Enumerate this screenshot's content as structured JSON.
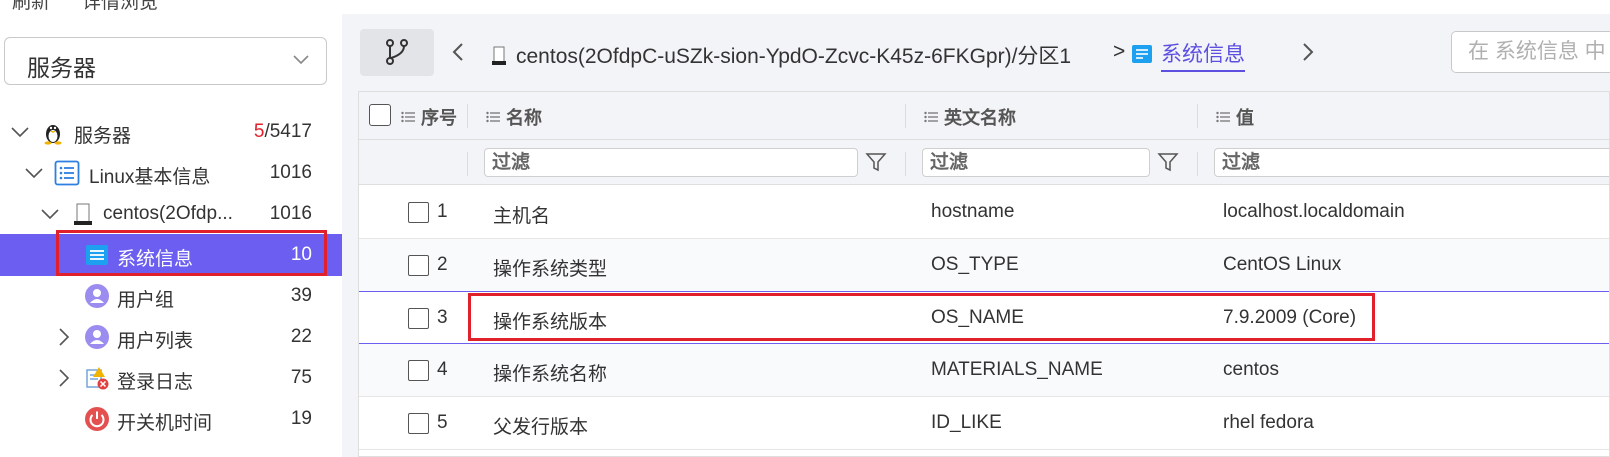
{
  "top_strip": {
    "left_text": "刷新",
    "right_text": "详情浏览"
  },
  "sidebar": {
    "dropdown": {
      "value": "服务器",
      "icon": "chevron-down-icon"
    },
    "tree": [
      {
        "label": "服务器",
        "count_hi": "5",
        "count_rest": "/5417",
        "icon": "linux-penguin-icon",
        "expanded": true
      },
      {
        "label": "Linux基本信息",
        "count": "1016",
        "icon": "list-doc-icon",
        "expanded": true
      },
      {
        "label": "centos(2Ofdp...",
        "count": "1016",
        "icon": "server-icon",
        "expanded": true
      },
      {
        "label": "系统信息",
        "count": "10",
        "icon": "system-info-icon",
        "selected": true
      },
      {
        "label": "用户组",
        "count": "39",
        "icon": "user-group-icon"
      },
      {
        "label": "用户列表",
        "count": "22",
        "icon": "user-list-icon",
        "expandable": true
      },
      {
        "label": "登录日志",
        "count": "75",
        "icon": "login-log-icon",
        "expandable": true
      },
      {
        "label": "开关机时间",
        "count": "19",
        "icon": "power-icon"
      }
    ]
  },
  "toolbar": {
    "path": "centos(2OfdpC-uSZk-sion-YpdO-Zcvc-K45z-6FKGpr)/分区1",
    "separator": ">",
    "crumb": "系统信息",
    "search_placeholder": "在 系统信息 中"
  },
  "table": {
    "headers": {
      "index": "序号",
      "name": "名称",
      "english": "英文名称",
      "value": "值"
    },
    "filter_placeholder": "过滤",
    "rows": [
      {
        "index": "1",
        "name": "主机名",
        "english": "hostname",
        "value": "localhost.localdomain"
      },
      {
        "index": "2",
        "name": "操作系统类型",
        "english": "OS_TYPE",
        "value": "CentOS Linux"
      },
      {
        "index": "3",
        "name": "操作系统版本",
        "english": "OS_NAME",
        "value": "7.9.2009 (Core)"
      },
      {
        "index": "4",
        "name": "操作系统名称",
        "english": "MATERIALS_NAME",
        "value": "centos"
      },
      {
        "index": "5",
        "name": "父发行版本",
        "english": "ID_LIKE",
        "value": "rhel fedora"
      }
    ]
  },
  "colors": {
    "accent": "#6b5ef0",
    "highlight_box": "#e0202a",
    "link": "#5d4fe0"
  }
}
